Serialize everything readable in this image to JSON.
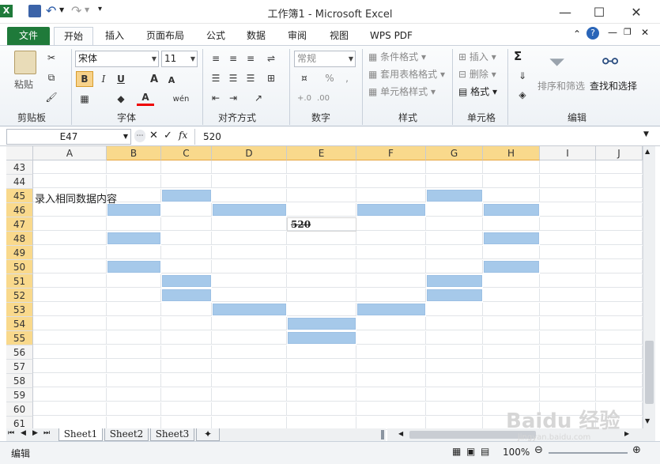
{
  "window": {
    "title": "工作簿1 - Microsoft Excel",
    "minimize": "—",
    "maximize": "☐",
    "close": "✕"
  },
  "quick_access": {
    "save": "💾",
    "undo": "↶",
    "redo": "↷"
  },
  "tabs": [
    {
      "label": "文件"
    },
    {
      "label": "开始"
    },
    {
      "label": "插入"
    },
    {
      "label": "页面布局"
    },
    {
      "label": "公式"
    },
    {
      "label": "数据"
    },
    {
      "label": "审阅"
    },
    {
      "label": "视图"
    },
    {
      "label": "WPS PDF"
    }
  ],
  "ribbon": {
    "clipboard": {
      "paste": "粘贴",
      "label": "剪贴板"
    },
    "font": {
      "name": "宋体",
      "size": "11",
      "bold": "B",
      "italic": "I",
      "underline": "U",
      "grow": "A",
      "shrink": "A",
      "color_a": "A",
      "wen": "wén",
      "label": "字体"
    },
    "alignment": {
      "label": "对齐方式"
    },
    "number": {
      "format": "常规",
      "percent": "%",
      "comma": ",",
      "label": "数字"
    },
    "styles": {
      "conditional": "条件格式",
      "table": "套用表格格式",
      "cell": "单元格样式",
      "label": "样式"
    },
    "cells": {
      "insert": "插入",
      "delete": "删除",
      "format": "格式",
      "label": "单元格"
    },
    "editing": {
      "sigma": "Σ",
      "sort": "排序和筛选",
      "find": "查找和选择",
      "label": "编辑"
    }
  },
  "formula_bar": {
    "name_box": "E47",
    "fx": "fx",
    "value": "520"
  },
  "grid": {
    "columns": [
      "A",
      "B",
      "C",
      "D",
      "E",
      "F",
      "G",
      "H",
      "I",
      "J"
    ],
    "selected_columns": [
      "B",
      "C",
      "D",
      "E",
      "F",
      "G",
      "H"
    ],
    "rows": [
      "43",
      "44",
      "45",
      "46",
      "47",
      "48",
      "49",
      "50",
      "51",
      "52",
      "53",
      "54",
      "55",
      "56",
      "57",
      "58",
      "59",
      "60",
      "61"
    ],
    "selected_rows": [
      "45",
      "46",
      "47",
      "48",
      "49",
      "50",
      "51",
      "52",
      "53",
      "54",
      "55"
    ],
    "cell_text": {
      "A45": "录入相同数据内容",
      "E47": "520"
    },
    "highlighted_cells": [
      "C45",
      "G45",
      "B46",
      "D46",
      "F46",
      "H46",
      "B48",
      "H48",
      "B50",
      "H50",
      "C51",
      "G51",
      "C52",
      "G52",
      "D53",
      "F53",
      "E54",
      "E55"
    ]
  },
  "sheets": [
    {
      "label": "Sheet1"
    },
    {
      "label": "Sheet2"
    },
    {
      "label": "Sheet3"
    }
  ],
  "status": {
    "mode": "编辑",
    "zoom": "100%"
  },
  "watermark": {
    "text": "Baidu 经验",
    "url": "jingyan.baidu.com"
  }
}
